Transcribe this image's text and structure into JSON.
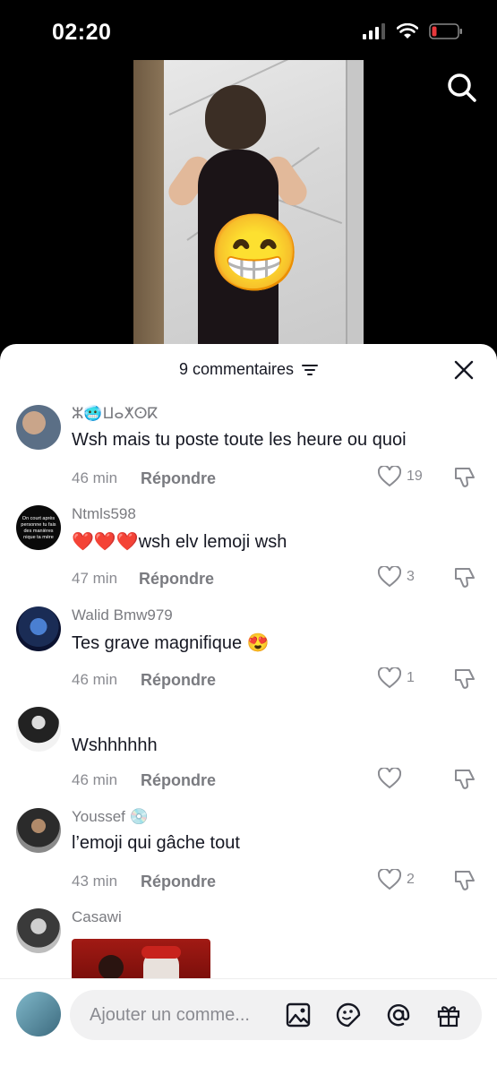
{
  "status": {
    "time": "02:20"
  },
  "header": {
    "count_label": "9 commentaires"
  },
  "comments": [
    {
      "user": "ⵣ🥶ⵡⴰⵅⵙⴽ",
      "text": "Wsh mais tu poste toute les heure ou quoi",
      "time": "46 min",
      "likes": "19"
    },
    {
      "user": "Ntmls598",
      "text": "❤️❤️❤️wsh elv lemoji wsh",
      "time": "47 min",
      "likes": "3"
    },
    {
      "user": "Walid Bmw979",
      "text": "Tes grave magnifique 😍",
      "time": "46 min",
      "likes": "1"
    },
    {
      "user": "",
      "text": "Wshhhhhh",
      "time": "46 min",
      "likes": ""
    },
    {
      "user": "Youssef 💿",
      "text": "l’emoji qui gâche tout",
      "time": "43 min",
      "likes": "2"
    },
    {
      "user": "Casawi",
      "text": "",
      "time": "",
      "likes": ""
    }
  ],
  "avatar2_text": "On court après personne tu fais des manières nique ta mère",
  "reply_label": "Répondre",
  "video": {
    "emoji": "😁"
  },
  "input": {
    "placeholder": "Ajouter un comme..."
  },
  "icons": [
    "search-icon",
    "filter-icon",
    "close-icon",
    "heart-icon",
    "dislike-icon",
    "image-icon",
    "sticker-icon",
    "mention-icon",
    "gift-icon"
  ],
  "colors": {
    "text": "#161823",
    "muted": "#8a8b91",
    "sheet": "#ffffff"
  }
}
